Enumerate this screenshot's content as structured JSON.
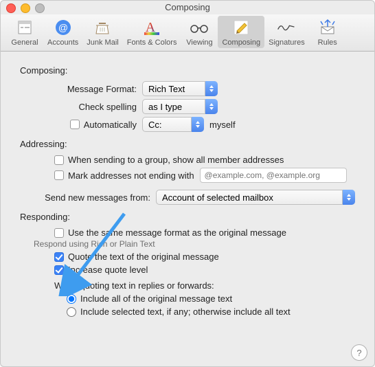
{
  "title": "Composing",
  "toolbar": [
    {
      "label": "General"
    },
    {
      "label": "Accounts"
    },
    {
      "label": "Junk Mail"
    },
    {
      "label": "Fonts & Colors"
    },
    {
      "label": "Viewing"
    },
    {
      "label": "Composing"
    },
    {
      "label": "Signatures"
    },
    {
      "label": "Rules"
    }
  ],
  "composing": {
    "heading": "Composing:",
    "message_format_label": "Message Format:",
    "message_format_value": "Rich Text",
    "check_spelling_label": "Check spelling",
    "check_spelling_value": "as I type",
    "auto_label": "Automatically",
    "auto_cc_value": "Cc:",
    "auto_suffix": "myself"
  },
  "addressing": {
    "heading": "Addressing:",
    "group_label": "When sending to a group, show all member addresses",
    "mark_label": "Mark addresses not ending with",
    "mark_placeholder": "@example.com, @example.org",
    "send_from_label": "Send new messages from:",
    "send_from_value": "Account of selected mailbox"
  },
  "responding": {
    "heading": "Responding:",
    "same_fmt_label": "Use the same message format as the original message",
    "sub_note": "Respond using Rich or Plain Text",
    "quote_label": "Quote the text of the original message",
    "increase_label": "Increase quote level",
    "when_quoting_heading": "When quoting text in replies or forwards:",
    "include_all_label": "Include all of the original message text",
    "include_sel_label": "Include selected text, if any; otherwise include all text"
  },
  "help": "?"
}
